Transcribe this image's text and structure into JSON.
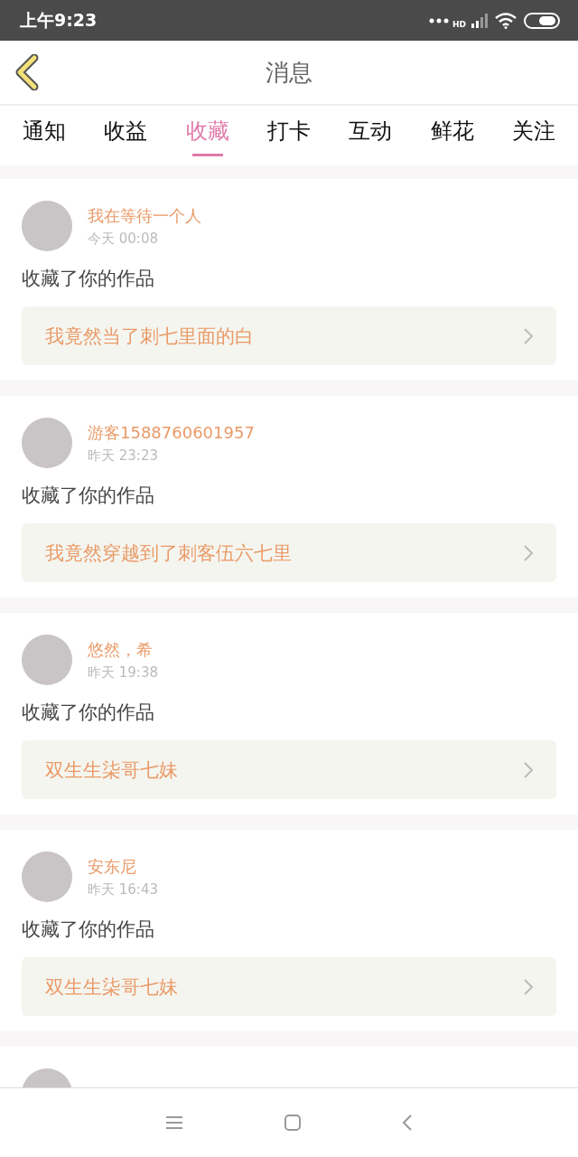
{
  "status_bar": {
    "time": "上午9:23",
    "network_label": "HD"
  },
  "header": {
    "title": "消息"
  },
  "tabs": [
    {
      "label": "通知",
      "selected": false
    },
    {
      "label": "收益",
      "selected": false
    },
    {
      "label": "收藏",
      "selected": true
    },
    {
      "label": "打卡",
      "selected": false
    },
    {
      "label": "互动",
      "selected": false
    },
    {
      "label": "鲜花",
      "selected": false
    },
    {
      "label": "关注",
      "selected": false
    }
  ],
  "messages": [
    {
      "user": "我在等待一个人",
      "time": "今天 00:08",
      "action": "收藏了你的作品",
      "work": "我竟然当了刺七里面的白"
    },
    {
      "user": "游客1588760601957",
      "time": "昨天 23:23",
      "action": "收藏了你的作品",
      "work": "我竟然穿越到了刺客伍六七里"
    },
    {
      "user": "悠然，希",
      "time": "昨天 19:38",
      "action": "收藏了你的作品",
      "work": "双生生柒哥七妹"
    },
    {
      "user": "安东尼",
      "time": "昨天 16:43",
      "action": "收藏了你的作品",
      "work": "双生生柒哥七妹"
    }
  ]
}
